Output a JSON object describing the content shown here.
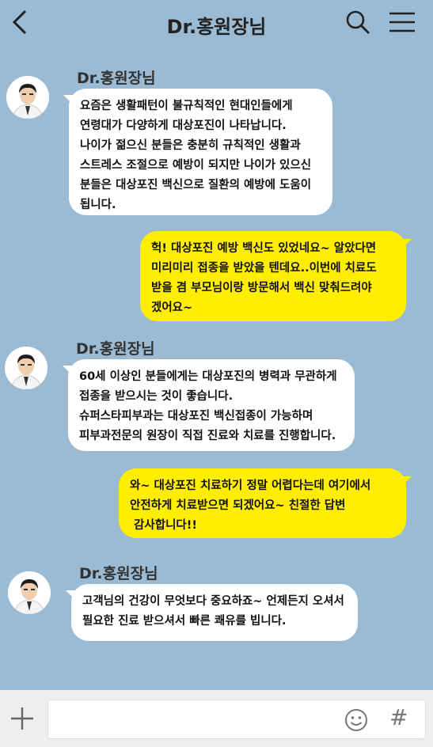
{
  "header": {
    "title": "Dr.홍원장님",
    "back_icon": "chevron-left-icon",
    "search_icon": "search-icon",
    "menu_icon": "menu-icon"
  },
  "messages": [
    {
      "direction": "incoming",
      "sender": "Dr.홍원장님",
      "lines": [
        "요즘은 생활패턴이 불규칙적인 현대인들에게",
        "연령대가 다양하게 대상포진이 나타납니다.",
        "나이가 젊으신 분들은 충분히 규칙적인 생활과",
        "스트레스 조절으로 예방이 되지만 나이가 있으신",
        "분들은 대상포진 백신으로 질환의 예방에 도움이",
        "됩니다."
      ]
    },
    {
      "direction": "outgoing",
      "lines": [
        "헉! 대상포진 예방 백신도 있었네요~ 알았다면",
        "미리미리 접종을 받았을 텐데요..이번에 치료도",
        "받을 겸 부모님이랑 방문해서 백신 맞춰드려야",
        "겠어요~"
      ]
    },
    {
      "direction": "incoming",
      "sender": "Dr.홍원장님",
      "lines": [
        "60세 이상인 분들에게는 대상포진의 병력과 무관하게",
        "접종을 받으시는 것이 좋습니다.",
        "슈퍼스타피부과는 대상포진 백신접종이 가능하며",
        "피부과전문의 원장이 직접 진료와 치료를 진행합니다."
      ]
    },
    {
      "direction": "outgoing",
      "lines": [
        "와~ 대상포진 치료하기 정말 어렵다는데 여기에서",
        "안전하게 치료받으면 되겠어요~ 친절한 답변",
        " 감사합니다!!"
      ]
    },
    {
      "direction": "incoming",
      "sender": "Dr.홍원장님",
      "lines": [
        "고객님의 건강이 무엇보다 중요하죠~ 언제든지 오셔서",
        "필요한 진료 받으셔서 빠른 쾌유를 빕니다."
      ]
    }
  ],
  "input": {
    "value": "",
    "plus_icon": "plus-icon",
    "emoji_icon": "emoji-icon",
    "hash_label": "#"
  }
}
